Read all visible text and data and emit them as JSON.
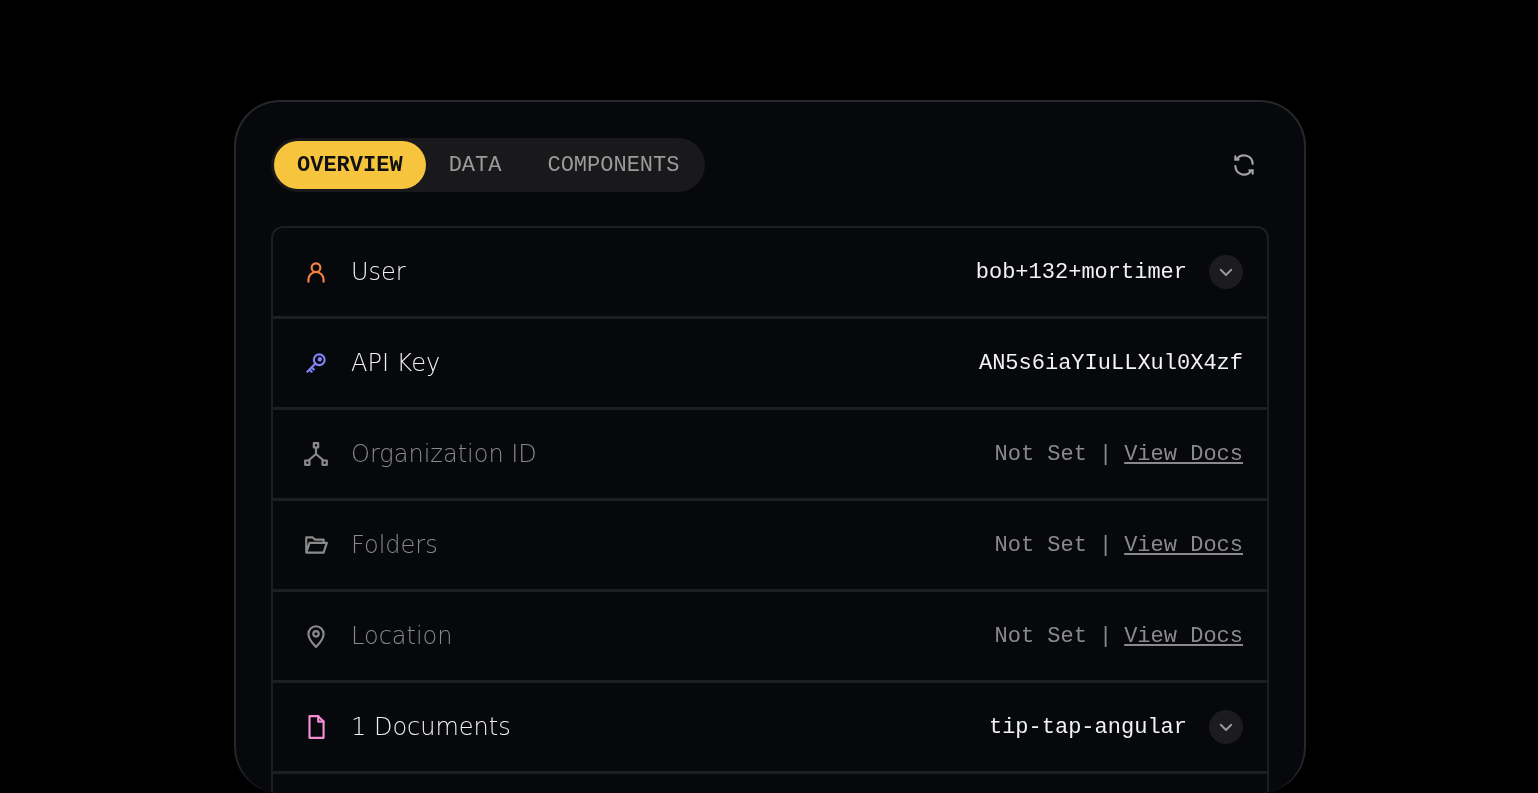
{
  "tabs": [
    {
      "label": "OVERVIEW",
      "selected": true
    },
    {
      "label": "DATA",
      "selected": false
    },
    {
      "label": "COMPONENTS",
      "selected": false
    }
  ],
  "rows": [
    {
      "kind": "expandable",
      "color": "#f7823f",
      "label": "User",
      "value": "bob+132+mortimer",
      "expanded": false
    },
    {
      "kind": "value",
      "color": "#7f84f6",
      "label": "API Key",
      "value": "AN5s6iaYIuLLXul0X4zf"
    },
    {
      "kind": "unset",
      "label": "Organization ID",
      "value": "Not Set",
      "separator": "|",
      "link": "View Docs"
    },
    {
      "kind": "unset",
      "label": "Folders",
      "value": "Not Set",
      "separator": "|",
      "link": "View Docs"
    },
    {
      "kind": "unset",
      "label": "Location",
      "value": "Not Set",
      "separator": "|",
      "link": "View Docs"
    },
    {
      "kind": "expandable",
      "color": "#f28fd4",
      "label": "1 Documents",
      "value": "tip-tap-angular",
      "expanded": false
    }
  ]
}
